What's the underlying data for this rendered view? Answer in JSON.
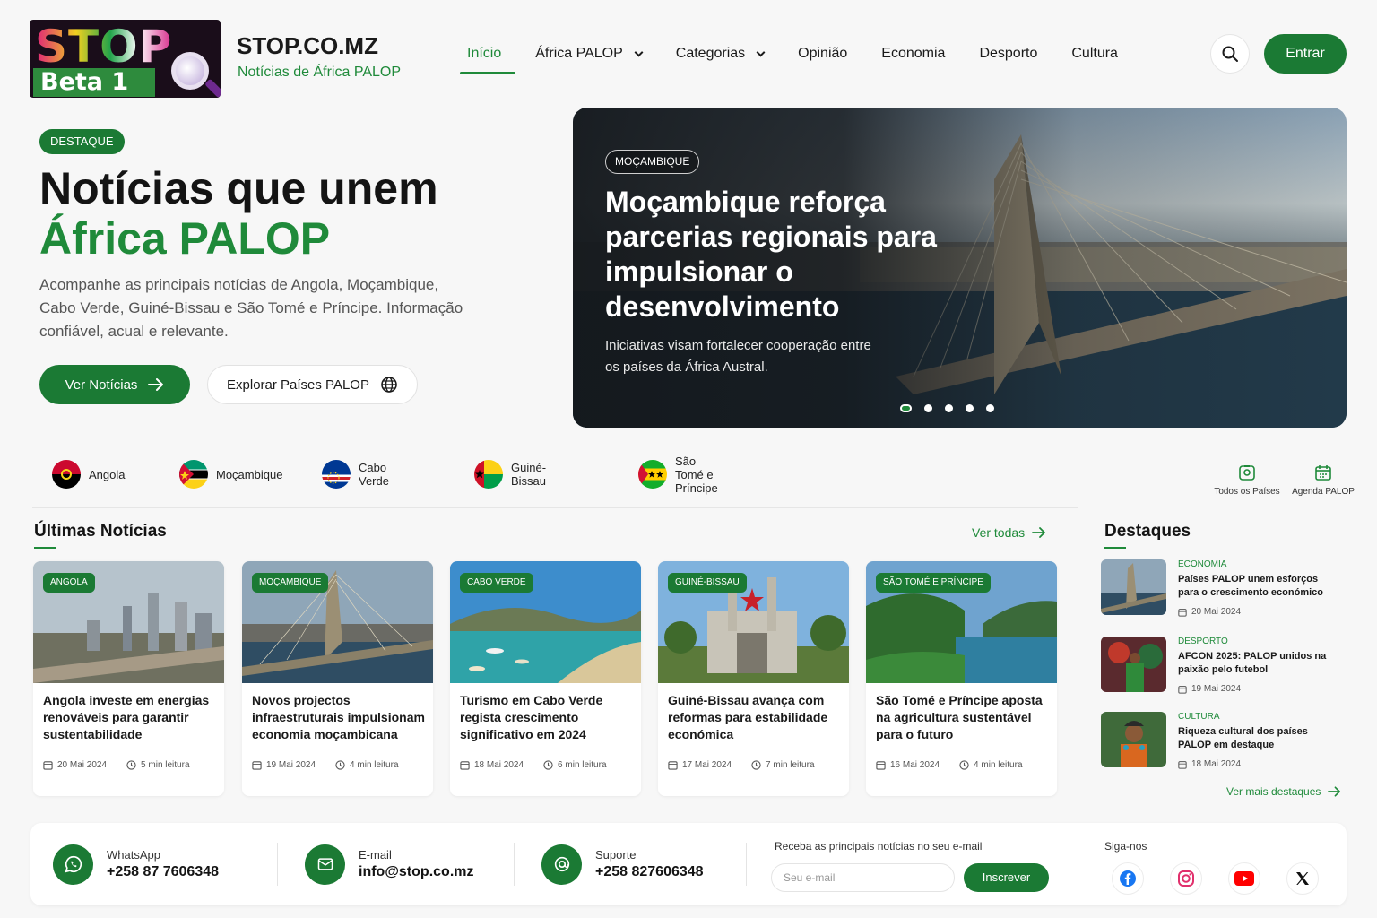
{
  "brand": {
    "logo_text": "STOP",
    "logo_badge": "Beta 1",
    "title": "STOP.CO.MZ",
    "subtitle": "Notícias de África PALOP"
  },
  "nav": {
    "items": [
      {
        "label": "Início",
        "active": true
      },
      {
        "label": "África PALOP",
        "dropdown": true
      },
      {
        "label": "Categorias",
        "dropdown": true
      },
      {
        "label": "Opinião"
      },
      {
        "label": "Economia"
      },
      {
        "label": "Desporto"
      },
      {
        "label": "Cultura"
      }
    ],
    "login_label": "Entrar"
  },
  "hero": {
    "badge": "DESTAQUE",
    "title_line1": "Notícias que unem",
    "title_line2": "África PALOP",
    "description": "Acompanhe as principais notícias de Angola, Moçambique, Cabo Verde, Guiné-Bissau e São Tomé e Príncipe. Informação confiável, acual e relevante.",
    "primary_button": "Ver Notícias",
    "secondary_button": "Explorar Países PALOP"
  },
  "featured": {
    "tag": "MOÇAMBIQUE",
    "title": "Moçambique reforça parcerias regionais para impulsionar o desenvolvimento",
    "subtitle": "Iniciativas visam fortalecer cooperação entre os países da África Austral.",
    "slides_count": 5,
    "active_slide": 1
  },
  "countries": [
    {
      "name": "Angola"
    },
    {
      "name": "Moçambique"
    },
    {
      "name": "Cabo Verde"
    },
    {
      "name": "Guiné-Bissau"
    },
    {
      "name": "São Tomé e Príncipe"
    }
  ],
  "quick_links": {
    "all_countries": "Todos os Países",
    "agenda": "Agenda PALOP"
  },
  "latest": {
    "title": "Últimas Notícias",
    "see_all": "Ver todas",
    "items": [
      {
        "tag": "ANGOLA",
        "title": "Angola investe em energias renováveis para garantir sustentabilidade",
        "date": "20 Mai 2024",
        "read": "5 min leitura"
      },
      {
        "tag": "MOÇAMBIQUE",
        "title": "Novos projectos infraestruturais impulsionam economia moçambicana",
        "date": "19 Mai 2024",
        "read": "4 min leitura"
      },
      {
        "tag": "CABO VERDE",
        "title": "Turismo em Cabo Verde regista crescimento significativo em 2024",
        "date": "18 Mai 2024",
        "read": "6 min leitura"
      },
      {
        "tag": "GUINÉ-BISSAU",
        "title": "Guiné-Bissau avança com reformas para estabilidade económica",
        "date": "17 Mai 2024",
        "read": "7 min leitura"
      },
      {
        "tag": "SÃO TOMÉ E PRÍNCIPE",
        "title": "São Tomé e Príncipe aposta na agricultura sustentável para o futuro",
        "date": "16 Mai 2024",
        "read": "4 min leitura"
      }
    ]
  },
  "highlights": {
    "title": "Destaques",
    "items": [
      {
        "category": "ECONOMIA",
        "title": "Países PALOP unem esforços para o crescimento económico",
        "date": "20 Mai 2024"
      },
      {
        "category": "DESPORTO",
        "title": "AFCON 2025: PALOP unidos na paixão pelo futebol",
        "date": "19 Mai 2024"
      },
      {
        "category": "CULTURA",
        "title": "Riqueza cultural dos países PALOP em destaque",
        "date": "18 Mai 2024"
      }
    ],
    "more": "Ver mais destaques"
  },
  "footer": {
    "whatsapp": {
      "label": "WhatsApp",
      "value": "+258 87 7606348"
    },
    "email": {
      "label": "E-mail",
      "value": "info@stop.co.mz"
    },
    "support": {
      "label": "Suporte",
      "value": "+258 827606348"
    },
    "newsletter": {
      "label": "Receba as principais notícias no seu e-mail",
      "placeholder": "Seu e-mail",
      "button": "Inscrever"
    },
    "follow": "Siga-nos",
    "socials": [
      "facebook-icon",
      "instagram-icon",
      "youtube-icon",
      "x-icon"
    ]
  },
  "colors": {
    "brand_green": "#1b7a34",
    "accent_green": "#1f8a3a"
  }
}
